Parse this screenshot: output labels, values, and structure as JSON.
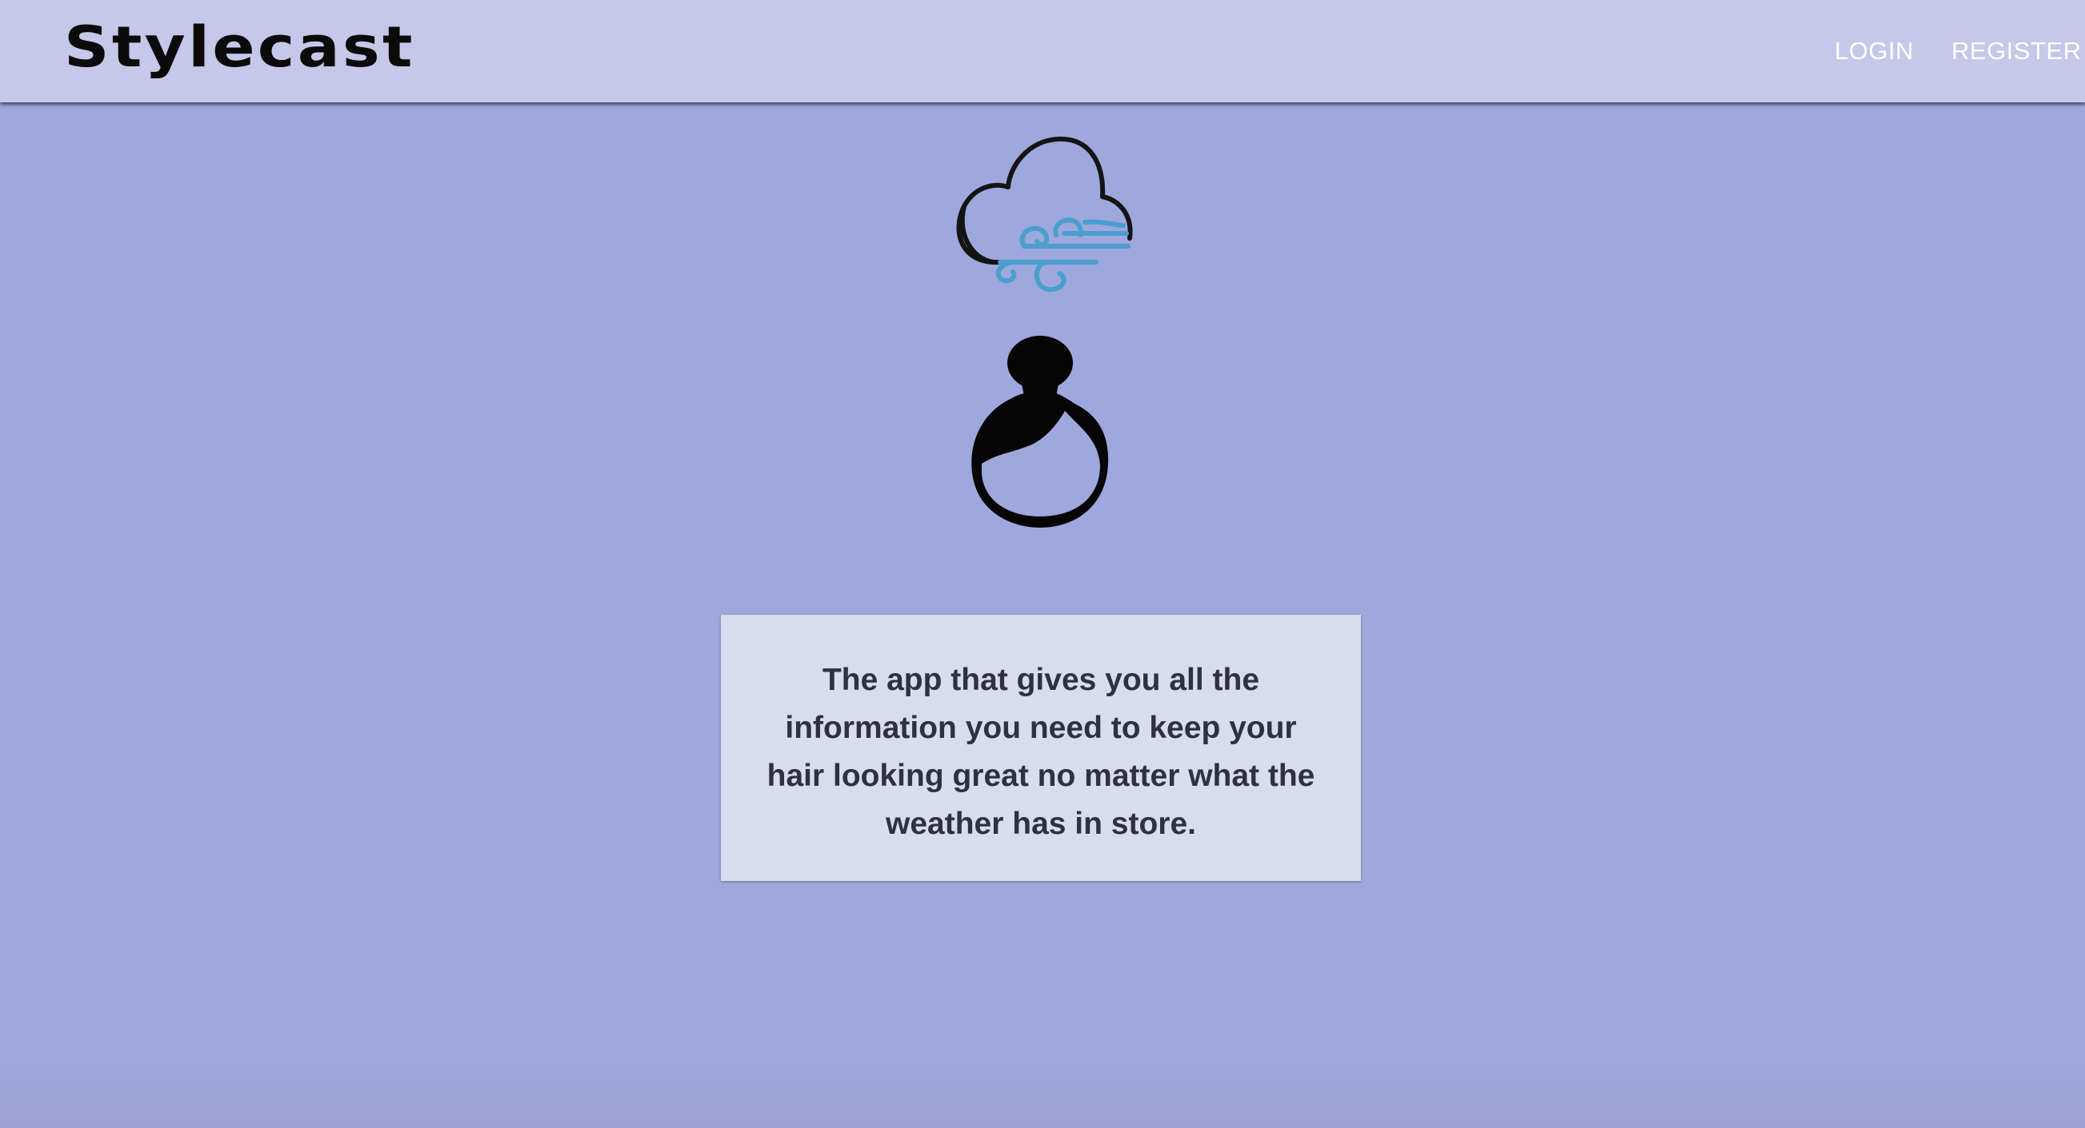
{
  "header": {
    "brand": "Stylecast",
    "nav": {
      "login_label": "LOGIN",
      "register_label": "REGISTER"
    },
    "background_color": "#c5c8e8"
  },
  "hero": {
    "icons": [
      "cloud-wind-icon",
      "hair-bun-icon"
    ],
    "wind_color": "#4a9fcf",
    "description": "The app that gives you all the information you need to keep your hair looking great no matter what the weather has in store."
  },
  "theme": {
    "page_background": "#9ea8dc",
    "card_background": "#d8dcef",
    "text_color": "#2f3140"
  }
}
